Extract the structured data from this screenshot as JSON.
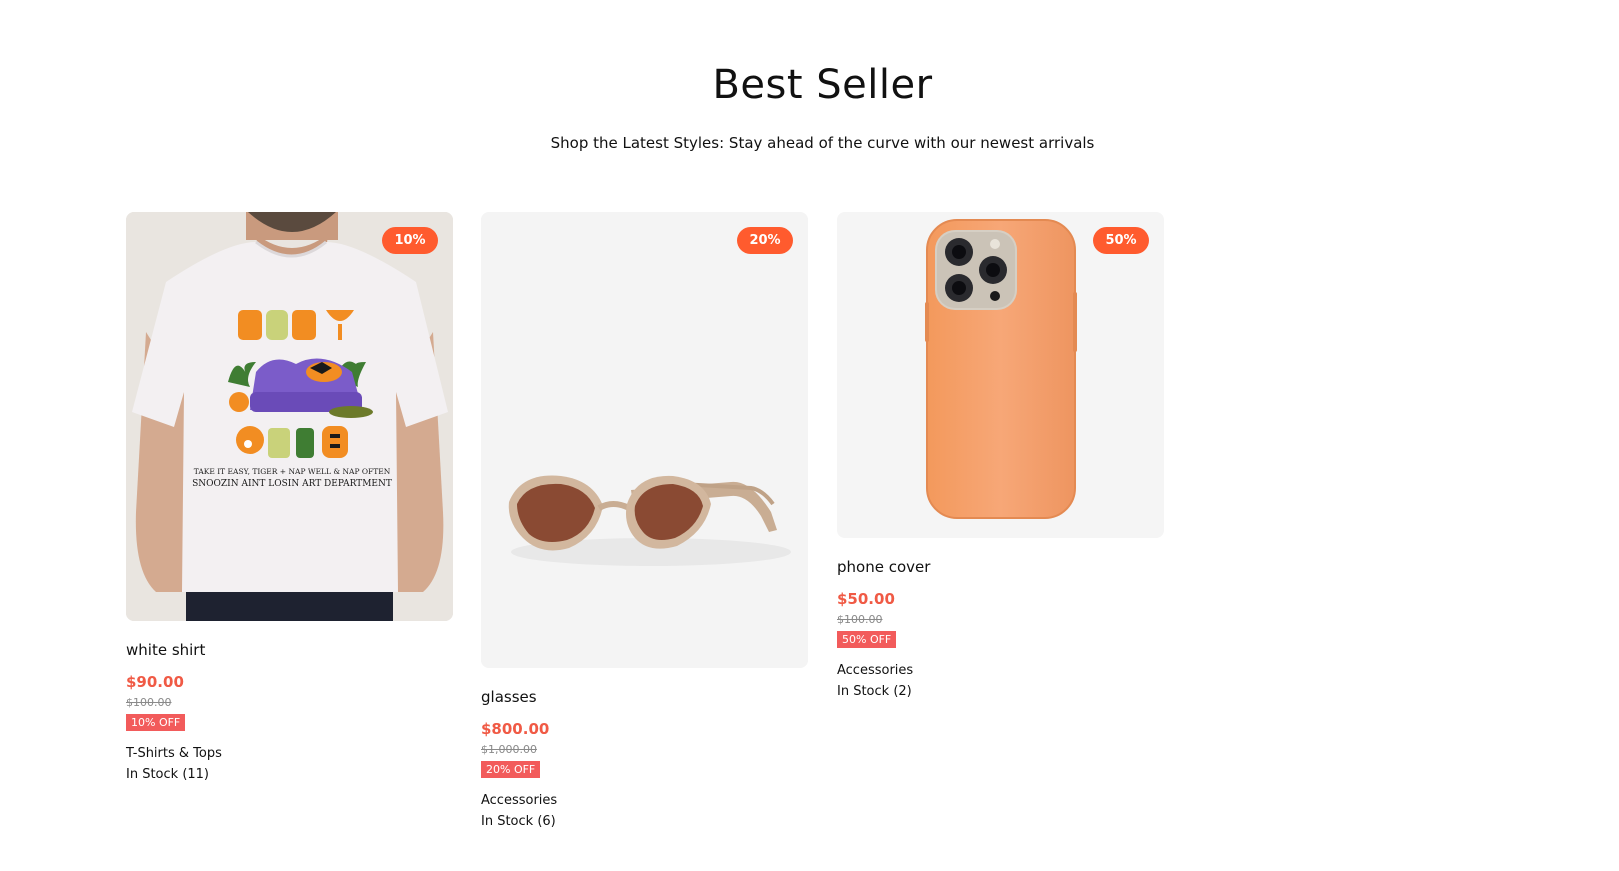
{
  "section": {
    "title": "Best Seller",
    "subtitle": "Shop the Latest Styles: Stay ahead of the curve with our newest arrivals"
  },
  "products": [
    {
      "name": "white shirt",
      "badge": "10%",
      "price": "$90.00",
      "original_price": "$100.00",
      "off_label": "10% OFF",
      "category": "T-Shirts & Tops",
      "stock": "In Stock (11)",
      "image": "white-tshirt-graphic-print",
      "image_text": [
        "TAKE IT EASY, TIGER + NAP WELL & NAP OFTEN",
        "SNOOZIN AINT LOSIN  ART DEPARTMENT"
      ]
    },
    {
      "name": "glasses",
      "badge": "20%",
      "price": "$800.00",
      "original_price": "$1,000.00",
      "off_label": "20% OFF",
      "category": "Accessories",
      "stock": "In Stock (6)",
      "image": "cat-eye-sunglasses"
    },
    {
      "name": "phone cover",
      "badge": "50%",
      "price": "$50.00",
      "original_price": "$100.00",
      "off_label": "50% OFF",
      "category": "Accessories",
      "stock": "In Stock (2)",
      "image": "orange-phone-case"
    }
  ],
  "colors": {
    "badge": "#ff5b2e",
    "price": "#f05a45",
    "off_tag": "#f25b5b"
  }
}
